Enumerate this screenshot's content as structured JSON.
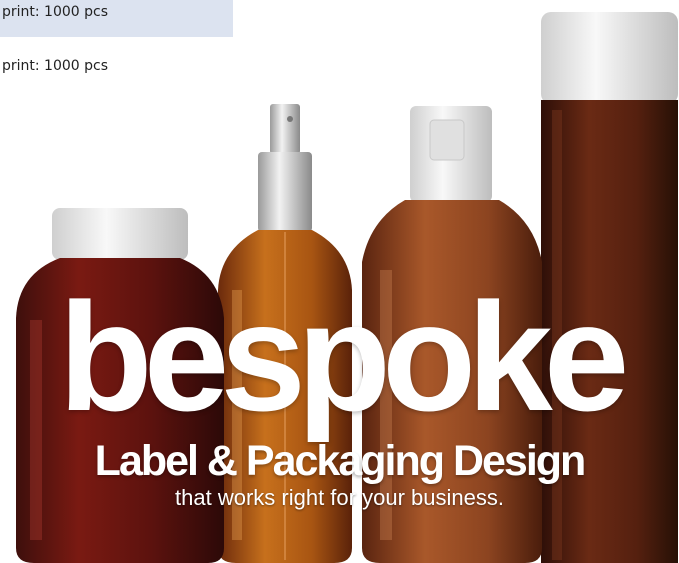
{
  "list": {
    "selected_row_label": "print: 1000 pcs",
    "row_label": "print: 1000 pcs"
  },
  "banner": {
    "brand_word": "bespoke",
    "tagline": "Label & Packaging Design",
    "subline": "that works right for your business.",
    "colors": {
      "amber": "#8a4218",
      "dark_amber": "#5a2412",
      "cap_white": "#eeeeee",
      "text": "#ffffff"
    }
  }
}
